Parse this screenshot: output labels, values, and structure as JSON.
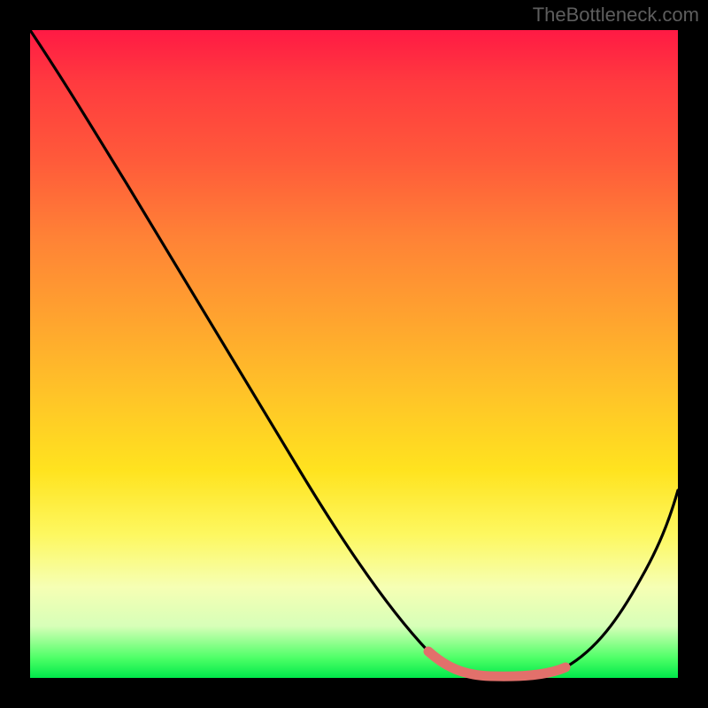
{
  "watermark": "TheBottleneck.com",
  "colors": {
    "frame": "#000000",
    "curve": "#000000",
    "highlight": "#e2706b",
    "watermark": "#5e5e5e"
  },
  "chart_data": {
    "type": "line",
    "title": "",
    "xlabel": "",
    "ylabel": "",
    "xlim": [
      0,
      100
    ],
    "ylim": [
      0,
      100
    ],
    "grid": false,
    "legend": false,
    "series": [
      {
        "name": "bottleneck-curve",
        "x": [
          0,
          5,
          10,
          15,
          20,
          25,
          30,
          35,
          40,
          45,
          50,
          55,
          60,
          63,
          66,
          70,
          74,
          78,
          82,
          86,
          90,
          94,
          97,
          100
        ],
        "values": [
          100,
          96,
          91,
          85,
          78,
          71,
          63,
          55,
          47,
          39,
          31,
          23,
          15,
          10,
          6,
          3,
          1,
          0,
          1,
          4,
          9,
          16,
          23,
          31
        ]
      },
      {
        "name": "trough-highlight",
        "x": [
          62,
          66,
          70,
          74,
          78,
          82
        ],
        "values": [
          3,
          1.5,
          0.5,
          0.2,
          0.5,
          1.5
        ]
      }
    ],
    "annotations": []
  }
}
